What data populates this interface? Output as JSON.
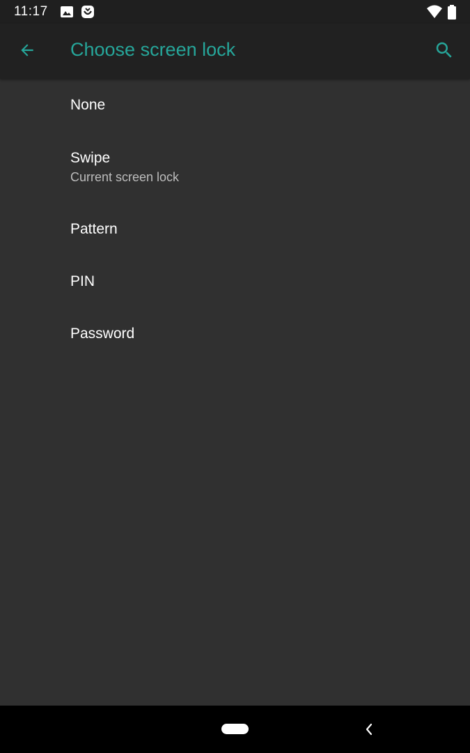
{
  "status_bar": {
    "time": "11:17",
    "icons": [
      "image-icon",
      "notification-app-icon",
      "wifi-icon",
      "battery-icon"
    ]
  },
  "app_bar": {
    "title": "Choose screen lock",
    "back_icon": "arrow-back-icon",
    "search_icon": "search-icon",
    "accent_color": "#26a69a"
  },
  "options": [
    {
      "title": "None"
    },
    {
      "title": "Swipe",
      "subtitle": "Current screen lock"
    },
    {
      "title": "Pattern"
    },
    {
      "title": "PIN"
    },
    {
      "title": "Password"
    }
  ],
  "nav_bar": {
    "home_icon": "home-pill-icon",
    "back_icon": "nav-back-icon"
  },
  "colors": {
    "background": "#303030",
    "app_bar": "#212121",
    "status_bar": "#1f1f1f",
    "text_primary": "#ffffff",
    "text_secondary": "#bdbdbd"
  }
}
